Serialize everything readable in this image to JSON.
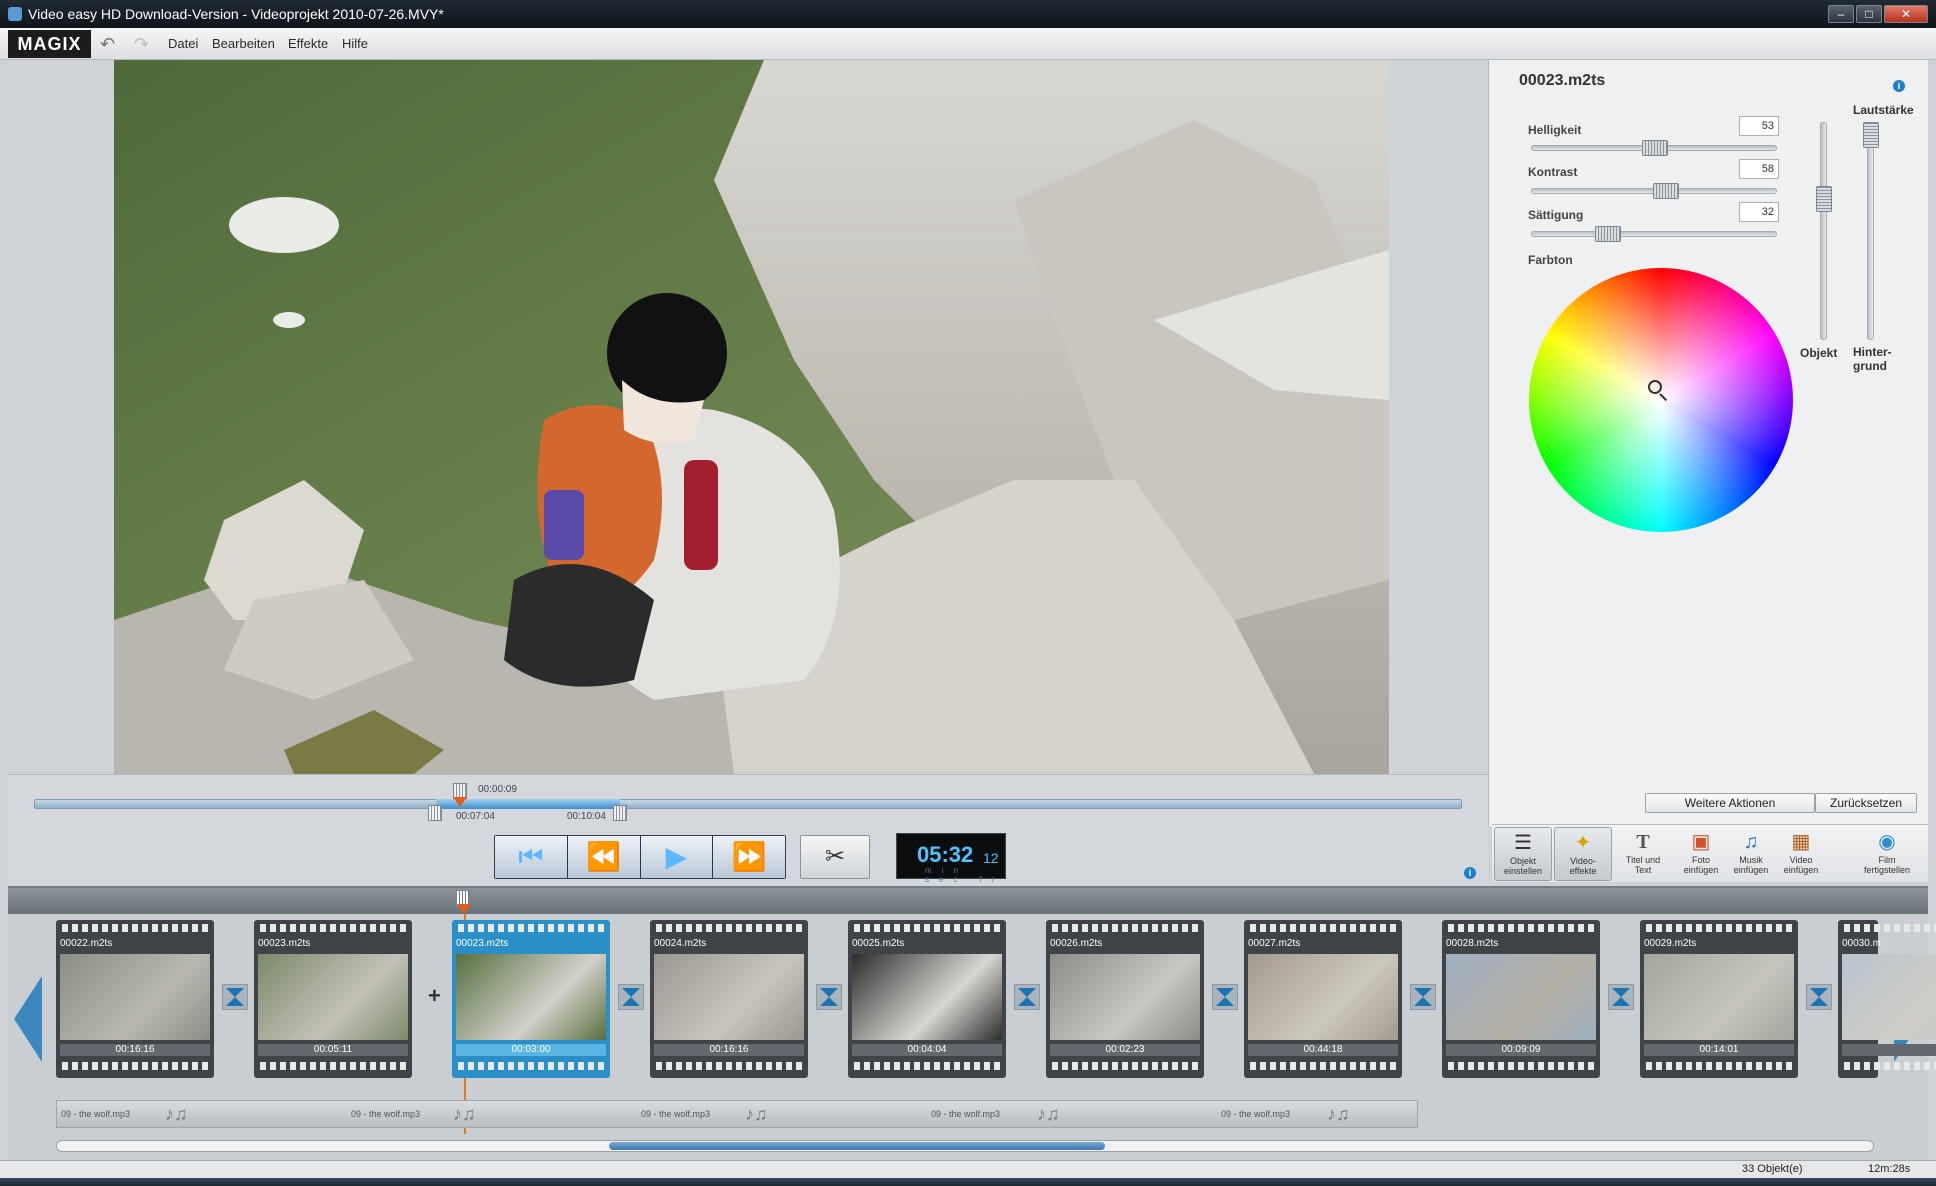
{
  "window": {
    "title": "Video easy HD Download-Version - Videoprojekt 2010-07-26.MVY*",
    "minimize": "–",
    "maximize": "□",
    "close": "✕"
  },
  "menubar": {
    "logo": "MAGIX",
    "items": [
      "Datei",
      "Bearbeiten",
      "Effekte",
      "Hilfe"
    ]
  },
  "panel": {
    "clip_title": "00023.m2ts",
    "sliders": [
      {
        "label": "Helligkeit",
        "value": "53",
        "level": 0.53
      },
      {
        "label": "Kontrast",
        "value": "58",
        "level": 0.58
      },
      {
        "label": "Sättigung",
        "value": "32",
        "level": 0.32
      }
    ],
    "farbton_label": "Farbton",
    "volume_label": "Lautstärke",
    "volume_object_label": "Objekt",
    "volume_background_label_1": "Hinter-",
    "volume_background_label_2": "grund",
    "more_actions": "Weitere Aktionen",
    "reset": "Zurücksetzen",
    "info": "i"
  },
  "tools": [
    {
      "l1": "Objekt",
      "l2": "einstellen",
      "icon": "sliders-icon",
      "active": true
    },
    {
      "l1": "Video-",
      "l2": "effekte",
      "icon": "magic-wand-icon",
      "active": true
    },
    {
      "l1": "Titel und",
      "l2": "Text",
      "icon": "title-icon",
      "active": false
    },
    {
      "l1": "Foto",
      "l2": "einfügen",
      "icon": "photo-add-icon",
      "active": false
    },
    {
      "l1": "Musik",
      "l2": "einfügen",
      "icon": "music-add-icon",
      "active": false
    },
    {
      "l1": "Video",
      "l2": "einfügen",
      "icon": "video-add-icon",
      "active": false
    },
    {
      "l1": "Film",
      "l2": "fertigstellen",
      "icon": "globe-icon",
      "active": false
    }
  ],
  "scrubber": {
    "position": "00:00:09",
    "in_point": "00:07:04",
    "out_point": "00:10:04"
  },
  "timecode": {
    "main": "05:32",
    "frames": "12",
    "units": "min sec fr"
  },
  "storyboard": {
    "clips": [
      {
        "name": "00022.m2ts",
        "duration": "00:16:16",
        "selected": false
      },
      {
        "name": "00023.m2ts",
        "duration": "00:05:11",
        "selected": false
      },
      {
        "name": "00023.m2ts",
        "duration": "00:03:00",
        "selected": true
      },
      {
        "name": "00024.m2ts",
        "duration": "00:16:16",
        "selected": false
      },
      {
        "name": "00025.m2ts",
        "duration": "00:04:04",
        "selected": false
      },
      {
        "name": "00026.m2ts",
        "duration": "00:02:23",
        "selected": false
      },
      {
        "name": "00027.m2ts",
        "duration": "00:44:18",
        "selected": false
      },
      {
        "name": "00028.m2ts",
        "duration": "00:09:09",
        "selected": false
      },
      {
        "name": "00029.m2ts",
        "duration": "00:14:01",
        "selected": false
      },
      {
        "name": "00030.m",
        "duration": "",
        "selected": false
      }
    ],
    "audio_label": "09 - the wolf.mp3"
  },
  "status": {
    "objects": "33 Objekt(e)",
    "length": "12m:28s"
  }
}
